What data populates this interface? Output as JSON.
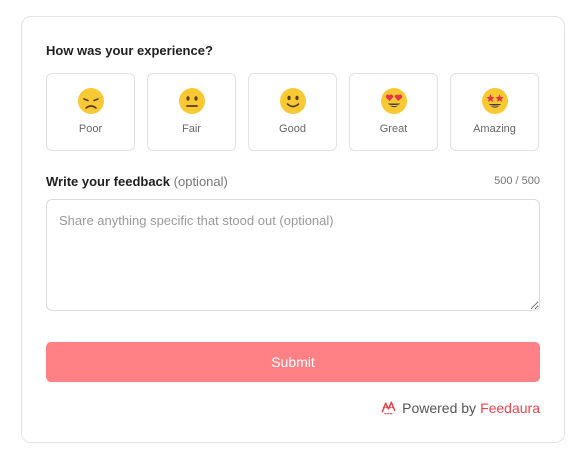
{
  "question": "How was your experience?",
  "ratings": [
    {
      "label": "Poor",
      "icon": "disappointed-face-icon"
    },
    {
      "label": "Fair",
      "icon": "neutral-face-icon"
    },
    {
      "label": "Good",
      "icon": "slightly-smiling-face-icon"
    },
    {
      "label": "Great",
      "icon": "heart-eyes-face-icon"
    },
    {
      "label": "Amazing",
      "icon": "star-struck-face-icon"
    }
  ],
  "feedback": {
    "label": "Write your feedback",
    "optional": "(optional)",
    "counter": "500 / 500",
    "placeholder": "Share anything specific that stood out (optional)"
  },
  "submit_label": "Submit",
  "footer": {
    "powered_by": "Powered by",
    "brand": "Feedaura",
    "logo_icon": "feedaura-logo-icon"
  },
  "colors": {
    "accent": "#ff8085",
    "brand": "#e8454e",
    "emoji_yellow": "#f9c934"
  }
}
